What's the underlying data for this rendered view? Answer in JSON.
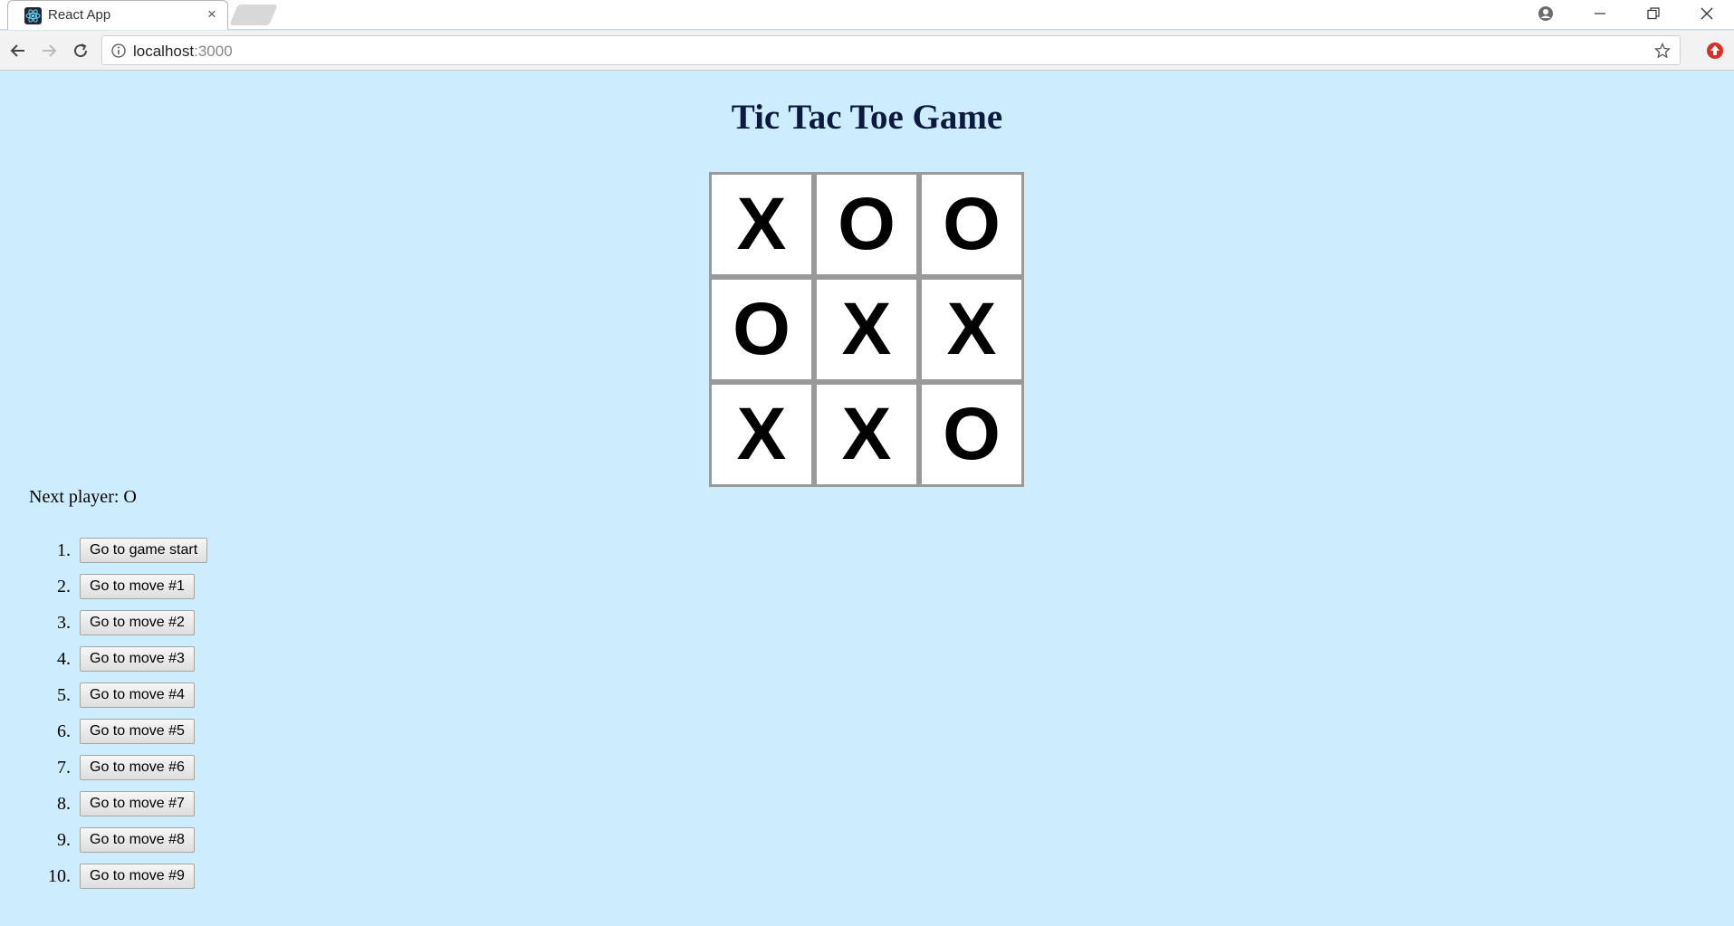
{
  "browser": {
    "tab_title": "React App",
    "tab_close": "×",
    "url_host": "localhost",
    "url_port": ":3000"
  },
  "page": {
    "title": "Tic Tac Toe Game"
  },
  "board": {
    "squares": [
      "X",
      "O",
      "O",
      "O",
      "X",
      "X",
      "X",
      "X",
      "O"
    ]
  },
  "status": "Next player: O",
  "moves": [
    {
      "num": "1.",
      "label": "Go to game start"
    },
    {
      "num": "2.",
      "label": "Go to move #1"
    },
    {
      "num": "3.",
      "label": "Go to move #2"
    },
    {
      "num": "4.",
      "label": "Go to move #3"
    },
    {
      "num": "5.",
      "label": "Go to move #4"
    },
    {
      "num": "6.",
      "label": "Go to move #5"
    },
    {
      "num": "7.",
      "label": "Go to move #6"
    },
    {
      "num": "8.",
      "label": "Go to move #7"
    },
    {
      "num": "9.",
      "label": "Go to move #8"
    },
    {
      "num": "10.",
      "label": "Go to move #9"
    }
  ],
  "colors": {
    "page_background": "#cdecfd",
    "title": "#0c1a40",
    "square_border": "#999999"
  }
}
